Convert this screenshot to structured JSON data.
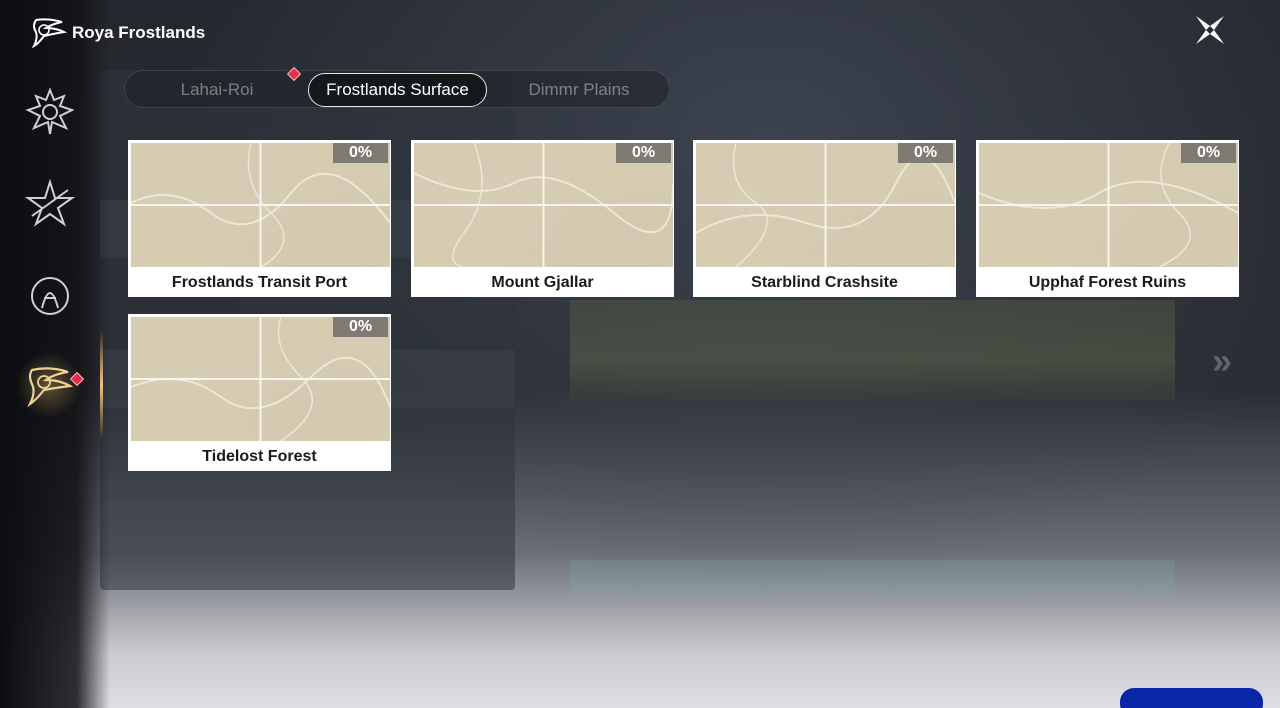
{
  "header": {
    "title": "Roya Frostlands"
  },
  "tabs": [
    {
      "label": "Lahai-Roi",
      "active": false,
      "alert": true
    },
    {
      "label": "Frostlands Surface",
      "active": true,
      "alert": false
    },
    {
      "label": "Dimmr Plains",
      "active": false,
      "alert": false
    }
  ],
  "areas": [
    {
      "name": "Frostlands Transit Port",
      "progress": "0%"
    },
    {
      "name": "Mount Gjallar",
      "progress": "0%"
    },
    {
      "name": "Starblind Crashsite",
      "progress": "0%"
    },
    {
      "name": "Upphaf Forest Ruins",
      "progress": "0%"
    },
    {
      "name": "Tidelost Forest",
      "progress": "0%"
    }
  ],
  "sidebar": {
    "items": [
      {
        "icon": "dragon-emblem-icon",
        "active": false
      },
      {
        "icon": "star-emblem-icon",
        "active": false
      },
      {
        "icon": "crest-emblem-icon",
        "active": false
      },
      {
        "icon": "roya-frostlands-emblem-icon",
        "active": true,
        "alert": true
      }
    ]
  },
  "colors": {
    "alert": "#e0304a",
    "active_glow": "#f3c27a",
    "card_bg": "#ffffff",
    "map_tint": "#d6ccb2",
    "progress_badge": "#6e6c66"
  }
}
